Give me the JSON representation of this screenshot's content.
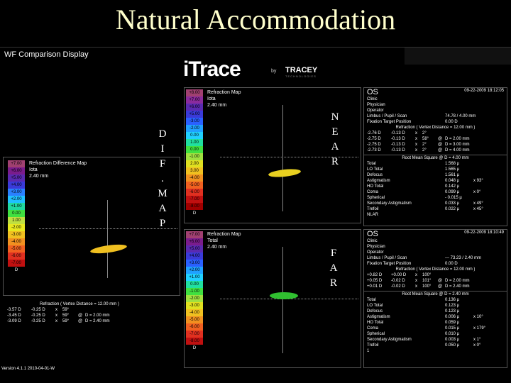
{
  "slide": {
    "title": "Natural Accommodation"
  },
  "app": {
    "window_title": "WF Comparison Display",
    "logo": {
      "brand": "iTrace",
      "by": "by",
      "company": "TRACEY",
      "sub": "TECHNOLOGIES"
    },
    "version": "Version 4.1.1 2010-04-01-W"
  },
  "labels": {
    "dif_map": [
      "D",
      "I",
      "F",
      ".",
      "M",
      "A",
      "P"
    ],
    "near": [
      "N",
      "E",
      "A",
      "R"
    ],
    "far": [
      "F",
      "A",
      "R"
    ]
  },
  "diff_map": {
    "title": [
      "Refraction Difference Map",
      "Iota",
      "2.40 mm"
    ],
    "scale": [
      "+7.00",
      "+6.00",
      "+5.00",
      "+4.00",
      "+3.00",
      "+2.00",
      "+1.00",
      "0.00",
      "1.00",
      "-2.00",
      "-3.00",
      "-4.00",
      "-5.00",
      "-6.00",
      "-7.00",
      "D"
    ],
    "refraction_header": "Refraction ( Vertex Distance = 12.00 mm )",
    "refraction_rows": [
      [
        "-3.57 D",
        "-0.25 D",
        "x",
        "59°",
        "",
        ""
      ],
      [
        "-3.45 D",
        "-0.25 D",
        "x",
        "59°",
        "@",
        "D = 2.00 mm"
      ],
      [
        "",
        "",
        "",
        "",
        "",
        ""
      ],
      [
        "-3.09 D",
        "-0.25 D",
        "x",
        "59°",
        "@",
        "D = 2.40 mm"
      ]
    ]
  },
  "near_map": {
    "title": [
      "Refraction Map",
      "Iota",
      "2.40 mm"
    ],
    "scale": [
      "+8.00",
      "+7.00",
      "+6.00",
      "+5.00",
      "-3.00",
      "-2.00",
      "0.00",
      "1.00",
      "0.00",
      "-1.00",
      "2.00",
      "3.00",
      "-4.00",
      "-5.00",
      "-6.00",
      "-7.00",
      "-8.00",
      "D"
    ]
  },
  "far_map": {
    "title": [
      "Refraction Map",
      "Total",
      "2.40 mm"
    ],
    "scale": [
      "+7.00",
      "+6.00",
      "+5.00",
      "+4.00",
      "+3.00",
      "+2.00",
      "+1.00",
      "0.00",
      "-1.00",
      "-2.00",
      "-3.00",
      "-4.00",
      "-5.00",
      "-6.00",
      "-7.00",
      "-8.00",
      "D"
    ]
  },
  "near_data": {
    "eye": "OS",
    "date": "09-22-2009 18:12:05",
    "info": [
      [
        "Clinic",
        ""
      ],
      [
        "Physician",
        ""
      ],
      [
        "Operator",
        ""
      ],
      [
        "Limbus / Pupil / Scan",
        "74.78 / 4.00 mm"
      ],
      [
        "Fixation Target Position",
        "0.00 D"
      ]
    ],
    "refraction_header": "Refraction ( Vertex Distance = 12.00 mm )",
    "refraction": [
      [
        "-2.76 D",
        "-0.13 D",
        "x",
        "2°",
        "",
        ""
      ],
      [
        "-2.75 D",
        "-0.13 D",
        "x",
        "58°",
        "@",
        "D = 2.00 mm"
      ],
      [
        "-2.75 D",
        "-0.13 D",
        "x",
        "2°",
        "@",
        "D = 3.00 mm"
      ],
      [
        "-2.73 D",
        "-0.13 D",
        "x",
        "2°",
        "@",
        "D = 4.00 mm"
      ]
    ],
    "rms_header": "Root Mean Square @ D = 4.00 mm",
    "rms": [
      [
        "Total",
        "1.568 µ",
        ""
      ],
      [
        "LO Total",
        "1.565 µ",
        ""
      ],
      [
        "Defocus",
        "1.561 µ",
        ""
      ],
      [
        "Astigmatism",
        "0.048 µ",
        "x  93°"
      ],
      [
        "HO Total",
        "0.142 µ",
        ""
      ],
      [
        "Coma",
        "0.099 µ",
        "x  0°"
      ],
      [
        "Spherical",
        "- 0.015 µ",
        ""
      ],
      [
        "Secondary Astigmatism",
        "0.033 µ",
        "x  49°"
      ],
      [
        "Trefoil",
        "0.022 µ",
        "x  45°"
      ],
      [
        "NLAR",
        "",
        ""
      ]
    ]
  },
  "far_data": {
    "eye": "OS",
    "date": "09-22-2009 18:10:49",
    "info": [
      [
        "Clinic",
        ""
      ],
      [
        "Physician",
        ""
      ],
      [
        "Operator",
        ""
      ],
      [
        "Limbus / Pupil / Scan",
        "--- 73.23 / 2.40 mm"
      ],
      [
        "Fixation Target Position",
        "0.00 D"
      ]
    ],
    "refraction_header": "Refraction ( Vertex Distance = 12.00 mm )",
    "refraction": [
      [
        "+0.82 D",
        "+0.00 D",
        "x",
        "100°",
        "",
        ""
      ],
      [
        "+0.05 D",
        "-0.02 D",
        "x",
        "101°",
        "@",
        "D = 2.00 mm"
      ],
      [
        "",
        "",
        "",
        "",
        "",
        ""
      ],
      [
        "+0.01 D",
        "-0.02 D",
        "x",
        "100°",
        "@",
        "D = 2.40 mm"
      ]
    ],
    "rms_header": "Root Mean Square @ D = 2.40 mm",
    "rms": [
      [
        "Total",
        "0.136 µ",
        ""
      ],
      [
        "LO Total",
        "0.123 µ",
        ""
      ],
      [
        "Defocus",
        "0.123 µ",
        ""
      ],
      [
        "Astigmatism",
        "0.006 µ",
        "x  10°"
      ],
      [
        "HO Total",
        "0.059 µ",
        ""
      ],
      [
        "Coma",
        "0.015 µ",
        "x  179°"
      ],
      [
        "Spherical",
        "0.010 µ",
        ""
      ],
      [
        "Secondary Astigmatism",
        "0.003 µ",
        "x  1°"
      ],
      [
        "Trefoil",
        "0.050 µ",
        "x  0°"
      ],
      [
        "1",
        "",
        ""
      ]
    ]
  },
  "colors": {
    "scale_diff": [
      "#a04070",
      "#7a1c8c",
      "#5a2ab0",
      "#3a3ad8",
      "#2a80ff",
      "#20c0ff",
      "#20d8a0",
      "#40e040",
      "#c0e040",
      "#e8e820",
      "#f0c020",
      "#f09020",
      "#f06020",
      "#e03020",
      "#c01010"
    ],
    "scale_near": [
      "#a04070",
      "#8a2b9c",
      "#5a2ab0",
      "#3a3ad8",
      "#2a60ff",
      "#20a0ff",
      "#20d0ff",
      "#20e0a0",
      "#40e040",
      "#a0e040",
      "#e0e020",
      "#f0c020",
      "#f09020",
      "#f06020",
      "#e03020",
      "#c01010",
      "#a00000"
    ],
    "scale_far": [
      "#a04070",
      "#7a1c8c",
      "#5a2ab0",
      "#3a3ad8",
      "#2a60ff",
      "#20a0ff",
      "#20d0ff",
      "#20e0a0",
      "#40e040",
      "#a0e040",
      "#e0e020",
      "#f0c020",
      "#f09020",
      "#f06020",
      "#e03020",
      "#c01010"
    ]
  }
}
